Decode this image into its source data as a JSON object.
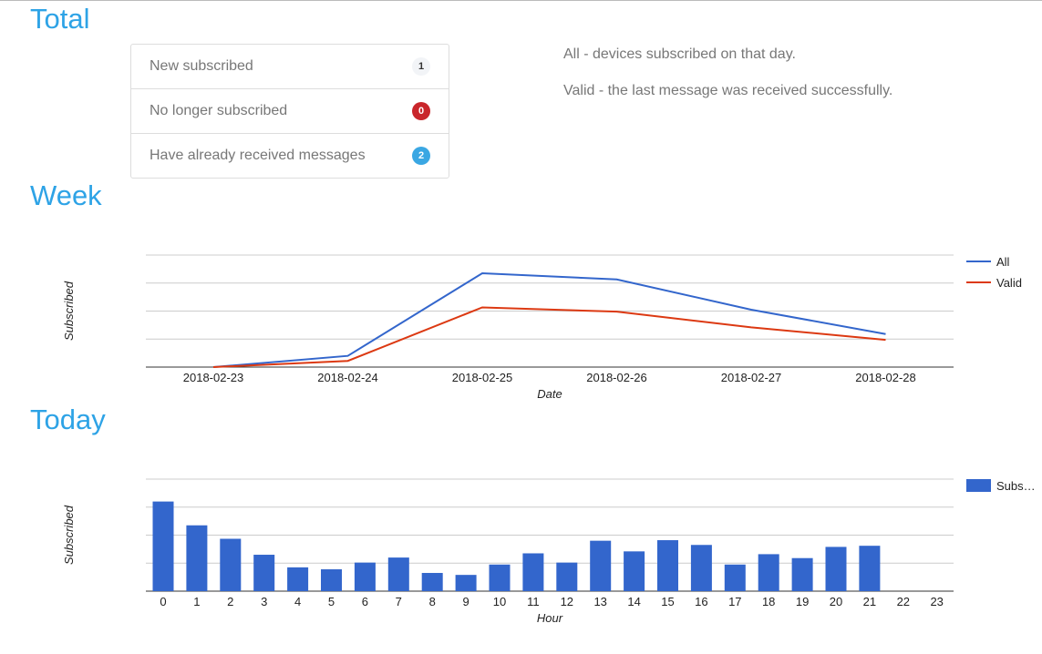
{
  "sections": {
    "total": "Total",
    "week": "Week",
    "today": "Today"
  },
  "stats": [
    {
      "label": "New subscribed",
      "count": "1",
      "color": "neutral"
    },
    {
      "label": "No longer subscribed",
      "count": "0",
      "color": "#c9262b"
    },
    {
      "label": "Have already received messages",
      "count": "2",
      "color": "#3aa7e3"
    }
  ],
  "notes": {
    "all": "All - devices subscribed on that day.",
    "valid": "Valid - the last message was received successfully."
  },
  "chart_data": [
    {
      "type": "line",
      "title": "",
      "xlabel": "Date",
      "ylabel": "Subscribed",
      "categories": [
        "2018-02-23",
        "2018-02-24",
        "2018-02-25",
        "2018-02-26",
        "2018-02-27",
        "2018-02-28"
      ],
      "ylim": [
        0,
        4
      ],
      "grid": true,
      "legend": "right",
      "series": [
        {
          "name": "All",
          "color": "#3366cc",
          "values": [
            0,
            0.4,
            3.35,
            3.13,
            2.05,
            1.18
          ]
        },
        {
          "name": "Valid",
          "color": "#dc3912",
          "values": [
            0,
            0.22,
            2.13,
            1.98,
            1.42,
            0.97
          ]
        }
      ]
    },
    {
      "type": "bar",
      "title": "",
      "xlabel": "Hour",
      "ylabel": "Subscribed",
      "categories": [
        "0",
        "1",
        "2",
        "3",
        "4",
        "5",
        "6",
        "7",
        "8",
        "9",
        "10",
        "11",
        "12",
        "13",
        "14",
        "15",
        "16",
        "17",
        "18",
        "19",
        "20",
        "21",
        "22",
        "23"
      ],
      "ylim": [
        0,
        4
      ],
      "grid": true,
      "legend": "right",
      "series": [
        {
          "name": "Subs…",
          "color": "#3366cc",
          "values": [
            3.2,
            2.35,
            1.87,
            1.3,
            0.85,
            0.78,
            1.02,
            1.2,
            0.65,
            0.58,
            0.95,
            1.35,
            1.02,
            1.8,
            1.42,
            1.82,
            1.65,
            0.95,
            1.32,
            1.18,
            1.58,
            1.62,
            0,
            0
          ]
        }
      ]
    }
  ]
}
